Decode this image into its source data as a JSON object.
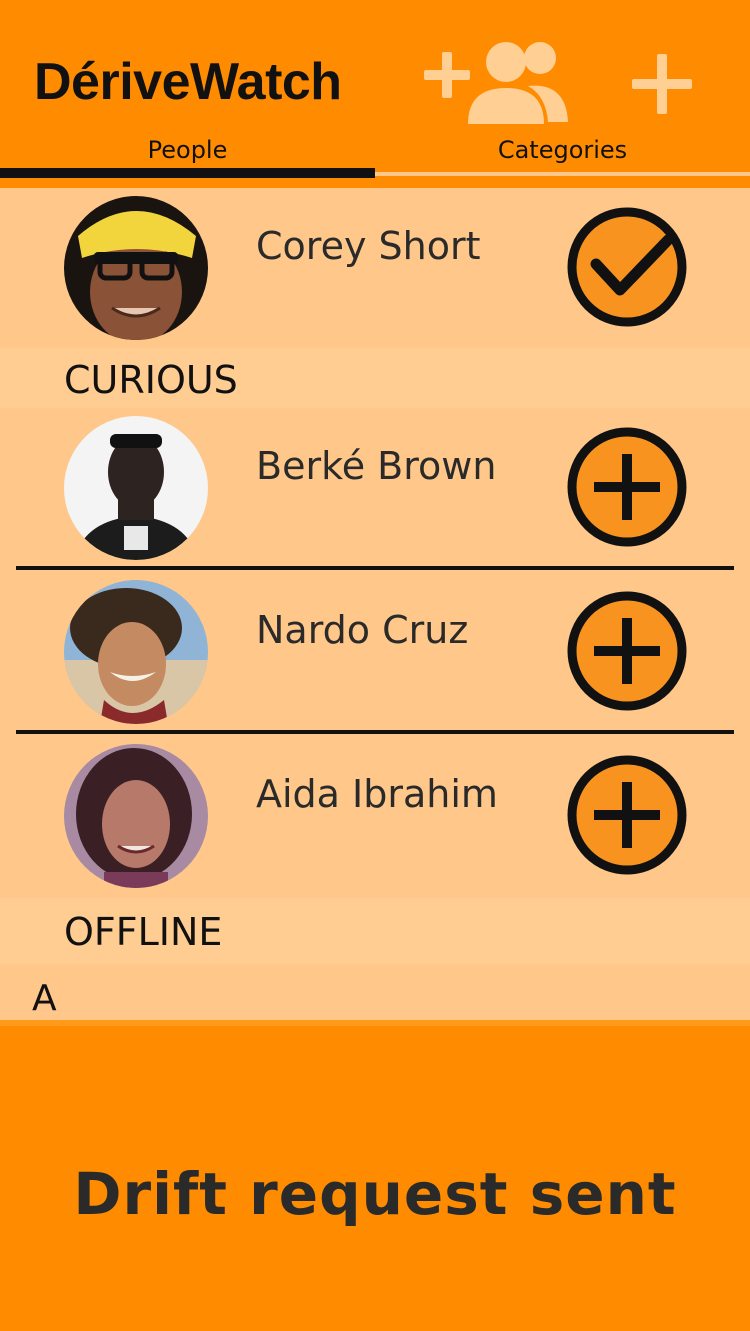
{
  "app": {
    "title": "DériveWatch"
  },
  "header": {
    "add_group_icon": "add-group-icon",
    "add_icon": "plus-icon"
  },
  "tabs": [
    {
      "label": "People",
      "active": true
    },
    {
      "label": "Categories",
      "active": false
    }
  ],
  "sections": [
    {
      "label": "",
      "people": [
        {
          "name": "Corey Short",
          "action": "checked",
          "action_icon": "check-circle-icon"
        }
      ]
    },
    {
      "label": "CURIOUS",
      "people": [
        {
          "name": "Berké Brown",
          "action": "add",
          "action_icon": "plus-circle-icon"
        },
        {
          "name": "Nardo Cruz",
          "action": "add",
          "action_icon": "plus-circle-icon"
        },
        {
          "name": "Aida Ibrahim",
          "action": "add",
          "action_icon": "plus-circle-icon"
        }
      ]
    },
    {
      "label": "OFFLINE",
      "people": []
    },
    {
      "label": "A",
      "people": []
    }
  ],
  "snackbar": {
    "message": "Drift request sent"
  },
  "colors": {
    "primary": "#ff8c00",
    "list_bg": "#ffc88a",
    "text": "#2a2a2a",
    "accent": "#f7931e"
  }
}
